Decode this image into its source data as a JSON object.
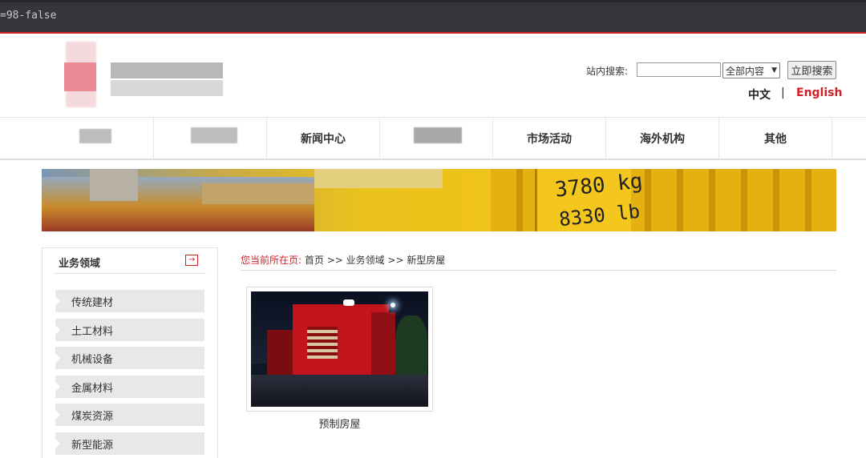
{
  "browser": {
    "url_fragment": "=98-false"
  },
  "header": {
    "search_label": "站内搜索:",
    "search_input_value": "",
    "search_scope_selected": "全部内容",
    "search_button": "立即搜索",
    "lang_zh": "中文",
    "lang_sep": "|",
    "lang_en": "English"
  },
  "nav": {
    "items": [
      "新闻中心",
      "市场活动",
      "海外机构",
      "其他"
    ]
  },
  "banner": {
    "plate_line1": "3780 kg",
    "plate_line2": "8330 lb"
  },
  "sidebar": {
    "title": "业务领域",
    "items": [
      "传统建材",
      "土工材料",
      "机械设备",
      "金属材料",
      "煤炭资源",
      "新型能源"
    ]
  },
  "breadcrumb": {
    "lead": "您当前所在页:",
    "path": "首页 >> 业务领域 >> 新型房屋"
  },
  "content": {
    "cards": [
      {
        "caption": "预制房屋"
      }
    ]
  },
  "colors": {
    "accent": "#d31f26",
    "sidebar_bg": "#e8e8e8"
  }
}
